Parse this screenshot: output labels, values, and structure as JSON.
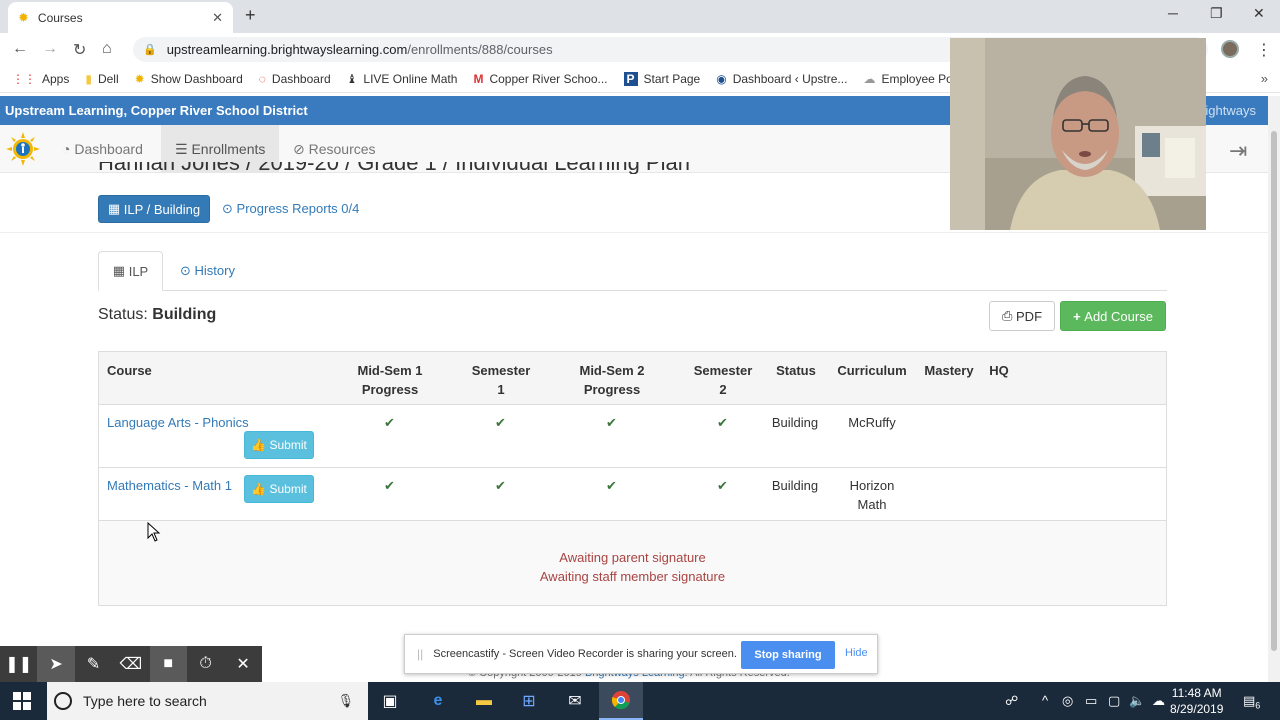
{
  "browser": {
    "tab_title": "Courses",
    "tab_close": "✕",
    "new_tab": "+",
    "url_host": "upstreamlearning.brightwayslearning.com",
    "url_path": "/enrollments/888/courses",
    "bookmarks": [
      {
        "label": "Apps",
        "icon": "apps-grid-icon"
      },
      {
        "label": "Dell",
        "icon": "folder-icon"
      },
      {
        "label": "Show Dashboard",
        "icon": "sun-icon"
      },
      {
        "label": "Dashboard",
        "icon": "ring-icon"
      },
      {
        "label": "LIVE Online Math",
        "icon": "math-icon"
      },
      {
        "label": "Copper River Schoo...",
        "icon": "gmail-icon"
      },
      {
        "label": "Start Page",
        "icon": "p-logo-icon"
      },
      {
        "label": "Dashboard ‹ Upstre...",
        "icon": "wp-icon"
      },
      {
        "label": "Employee Portal",
        "icon": "cloud-icon"
      }
    ]
  },
  "app": {
    "org_title": "Upstream Learning, Copper River School District",
    "brand_right": "ightways",
    "nav": [
      {
        "label": "Dashboard",
        "icon": "dashboard-icon"
      },
      {
        "label": "Enrollments",
        "icon": "list-icon"
      },
      {
        "label": "Resources",
        "icon": "compass-icon"
      }
    ],
    "page_title": "Hannah Jones / 2019-20 / Grade 1 / Individual Learning Plan",
    "ilp_button": "ILP / Building",
    "progress_link": "Progress Reports 0/4",
    "tabs": {
      "ilp": "ILP",
      "history": "History"
    },
    "status_label": "Status:",
    "status_value": "Building",
    "pdf_button": "PDF",
    "add_course_button": "Add Course",
    "table": {
      "headers": {
        "course": "Course",
        "mid1_a": "Mid-Sem 1",
        "mid1_b": "Progress",
        "sem1_a": "Semester",
        "sem1_b": "1",
        "mid2_a": "Mid-Sem 2",
        "mid2_b": "Progress",
        "sem2_a": "Semester",
        "sem2_b": "2",
        "status": "Status",
        "curriculum": "Curriculum",
        "mastery": "Mastery",
        "hq": "HQ"
      },
      "rows": [
        {
          "course": "Language Arts - Phonics",
          "submit": "Submit",
          "status": "Building",
          "curriculum_a": "McRuffy",
          "curriculum_b": ""
        },
        {
          "course": "Mathematics - Math 1",
          "submit": "Submit",
          "status": "Building",
          "curriculum_a": "Horizon",
          "curriculum_b": "Math"
        }
      ],
      "check_glyph": "✔",
      "warnings": [
        "Awaiting parent signature",
        "Awaiting staff member signature"
      ]
    },
    "footer": {
      "prefix": "© Copyright 2000-2019 ",
      "link": "Brightways Learning",
      "suffix": ". All Rights Reserved."
    }
  },
  "screencastify": {
    "share_message": "Screencastify - Screen Video Recorder is sharing your screen.",
    "stop_button": "Stop sharing",
    "hide_link": "Hide"
  },
  "taskbar": {
    "search_placeholder": "Type here to search",
    "time": "11:48 AM",
    "date": "8/29/2019",
    "notification_count": "6"
  }
}
